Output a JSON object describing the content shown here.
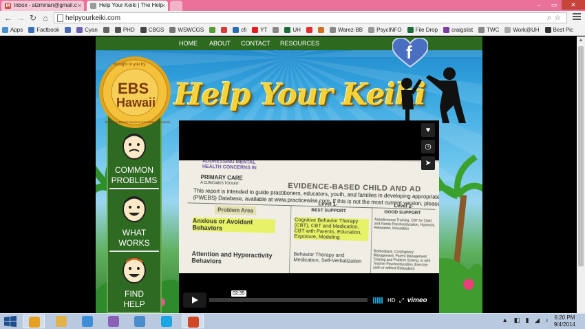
{
  "browser": {
    "tabs": [
      {
        "label": "Inbox - sizmirian@gmail.c",
        "icon": "gmail-icon"
      },
      {
        "label": "Help Your Keiki | The Help",
        "icon": "page-icon"
      }
    ],
    "url": "helpyourkeiki.com",
    "bookmarks": [
      {
        "label": "Apps",
        "color": "#4a8fd0"
      },
      {
        "label": "Factbook",
        "color": "#3b6fb6"
      },
      {
        "label": "",
        "color": "#4a68b3"
      },
      {
        "label": "Cyan",
        "color": "#6f5fb0"
      },
      {
        "label": "",
        "color": "#666666"
      },
      {
        "label": "PHD",
        "color": "#555555"
      },
      {
        "label": "CBGS",
        "color": "#444444"
      },
      {
        "label": "WSWCGS",
        "color": "#777777"
      },
      {
        "label": "",
        "color": "#5a9c3a"
      },
      {
        "label": "",
        "color": "#d93b3b"
      },
      {
        "label": "cfi",
        "color": "#2b6db0"
      },
      {
        "label": "YT",
        "color": "#e02020"
      },
      {
        "label": "",
        "color": "#888888"
      },
      {
        "label": "UH",
        "color": "#1d6a3a"
      },
      {
        "label": "",
        "color": "#e03030"
      },
      {
        "label": "",
        "color": "#d07020"
      },
      {
        "label": "Warez-BB",
        "color": "#8a8a8a"
      },
      {
        "label": "PsycINFO",
        "color": "#999999"
      },
      {
        "label": "File Drop",
        "color": "#1d6a3a"
      },
      {
        "label": "craigslist",
        "color": "#7a3fa0"
      },
      {
        "label": "TWC",
        "color": "#888888"
      },
      {
        "label": "Work@UH",
        "color": "#aaaaaa"
      },
      {
        "label": "Best Pic",
        "color": "#333333"
      }
    ]
  },
  "site": {
    "nav": [
      "HOME",
      "ABOUT",
      "CONTACT",
      "RESOURCES"
    ],
    "title": "Help Your Keiki",
    "logo": {
      "line1": "EBS",
      "line2": "Hawaii",
      "top_arc": "brought to you by",
      "ring": "Evidence Based Services Committee of Hawaii"
    },
    "side_items": [
      {
        "line1": "COMMON",
        "line2": "PROBLEMS"
      },
      {
        "line1": "WHAT",
        "line2": "WORKS"
      },
      {
        "line1": "FIND",
        "line2": "HELP"
      }
    ],
    "video": {
      "doc": {
        "head_left": "ADDRESSING Mental Health CONCERNS IN",
        "primary": "PRIMARY CARE",
        "subtitle": "A CLINICIAN'S TOOLKIT",
        "title": "EVIDENCE-BASED CHILD AND AD",
        "line1": "This report is intended to guide practitioners, educators, youth, and families in developing appropriate plans using",
        "line2": "(PWEBS) Database, available at www.practicewise.com. If this is not the most current version, please check",
        "col1": "Problem Area",
        "col2": "Level 1-",
        "col2b": "BEST SUPPORT",
        "col3": "Level 2-",
        "col3b": "GOOD SUPPORT",
        "row1_problem": "Anxious or Avoidant Behaviors",
        "row1_l1": "Cognitive Behavior Therapy (CBT), CBT and Medication, CBT with Parents, Education, Exposure, Modeling",
        "row1_l2": "Assertiveness Training, CBT for Child and Family Psychoeducation, Hypnosis, Relaxation, Inoculation",
        "row2_problem": "Attention and Hyperactivity Behaviors",
        "row2_l1": "Behavior Therapy and Medication, Self-Verbalization",
        "row2_l2": "Biofeedback, Contingency Management, Parent Management Training and Problem Solving, or with Teacher Psychoeducation, Exercise (with or without Relaxation)"
      },
      "time": "02:35",
      "hd": "HD",
      "brand": "vimeo"
    }
  },
  "taskbar": {
    "apps": [
      {
        "name": "chrome",
        "color": "#e5a126"
      },
      {
        "name": "explorer",
        "color": "#e2b34a"
      },
      {
        "name": "itunes",
        "color": "#3f8fd8"
      },
      {
        "name": "app4",
        "color": "#8a5fb5"
      },
      {
        "name": "app5",
        "color": "#4a8ccc"
      },
      {
        "name": "skype",
        "color": "#1aa6e2"
      },
      {
        "name": "powerpoint",
        "color": "#d24726"
      }
    ],
    "time": "6:20 PM",
    "date": "9/4/2014"
  }
}
